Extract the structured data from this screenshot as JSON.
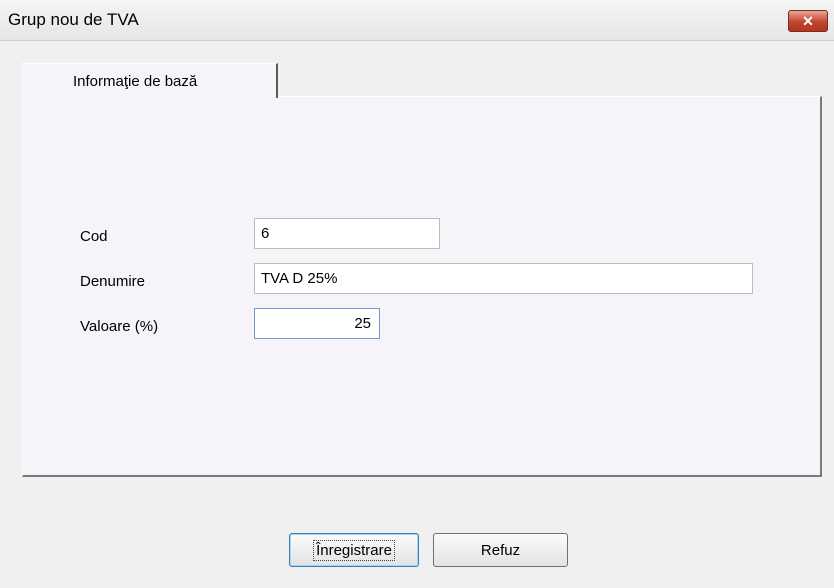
{
  "window": {
    "title": "Grup nou de TVA",
    "close_label": "✕"
  },
  "tabs": [
    {
      "label": "Informaţie de bază",
      "active": true
    }
  ],
  "form": {
    "cod": {
      "label": "Cod",
      "value": "6"
    },
    "denumire": {
      "label": "Denumire",
      "value": "TVA D 25%"
    },
    "valoare": {
      "label": "Valoare (%)",
      "value": "25"
    }
  },
  "buttons": {
    "save": "Înregistrare",
    "cancel": "Refuz"
  },
  "colors": {
    "close_button": "#c1442f",
    "focus_border": "#6b9ad6"
  }
}
